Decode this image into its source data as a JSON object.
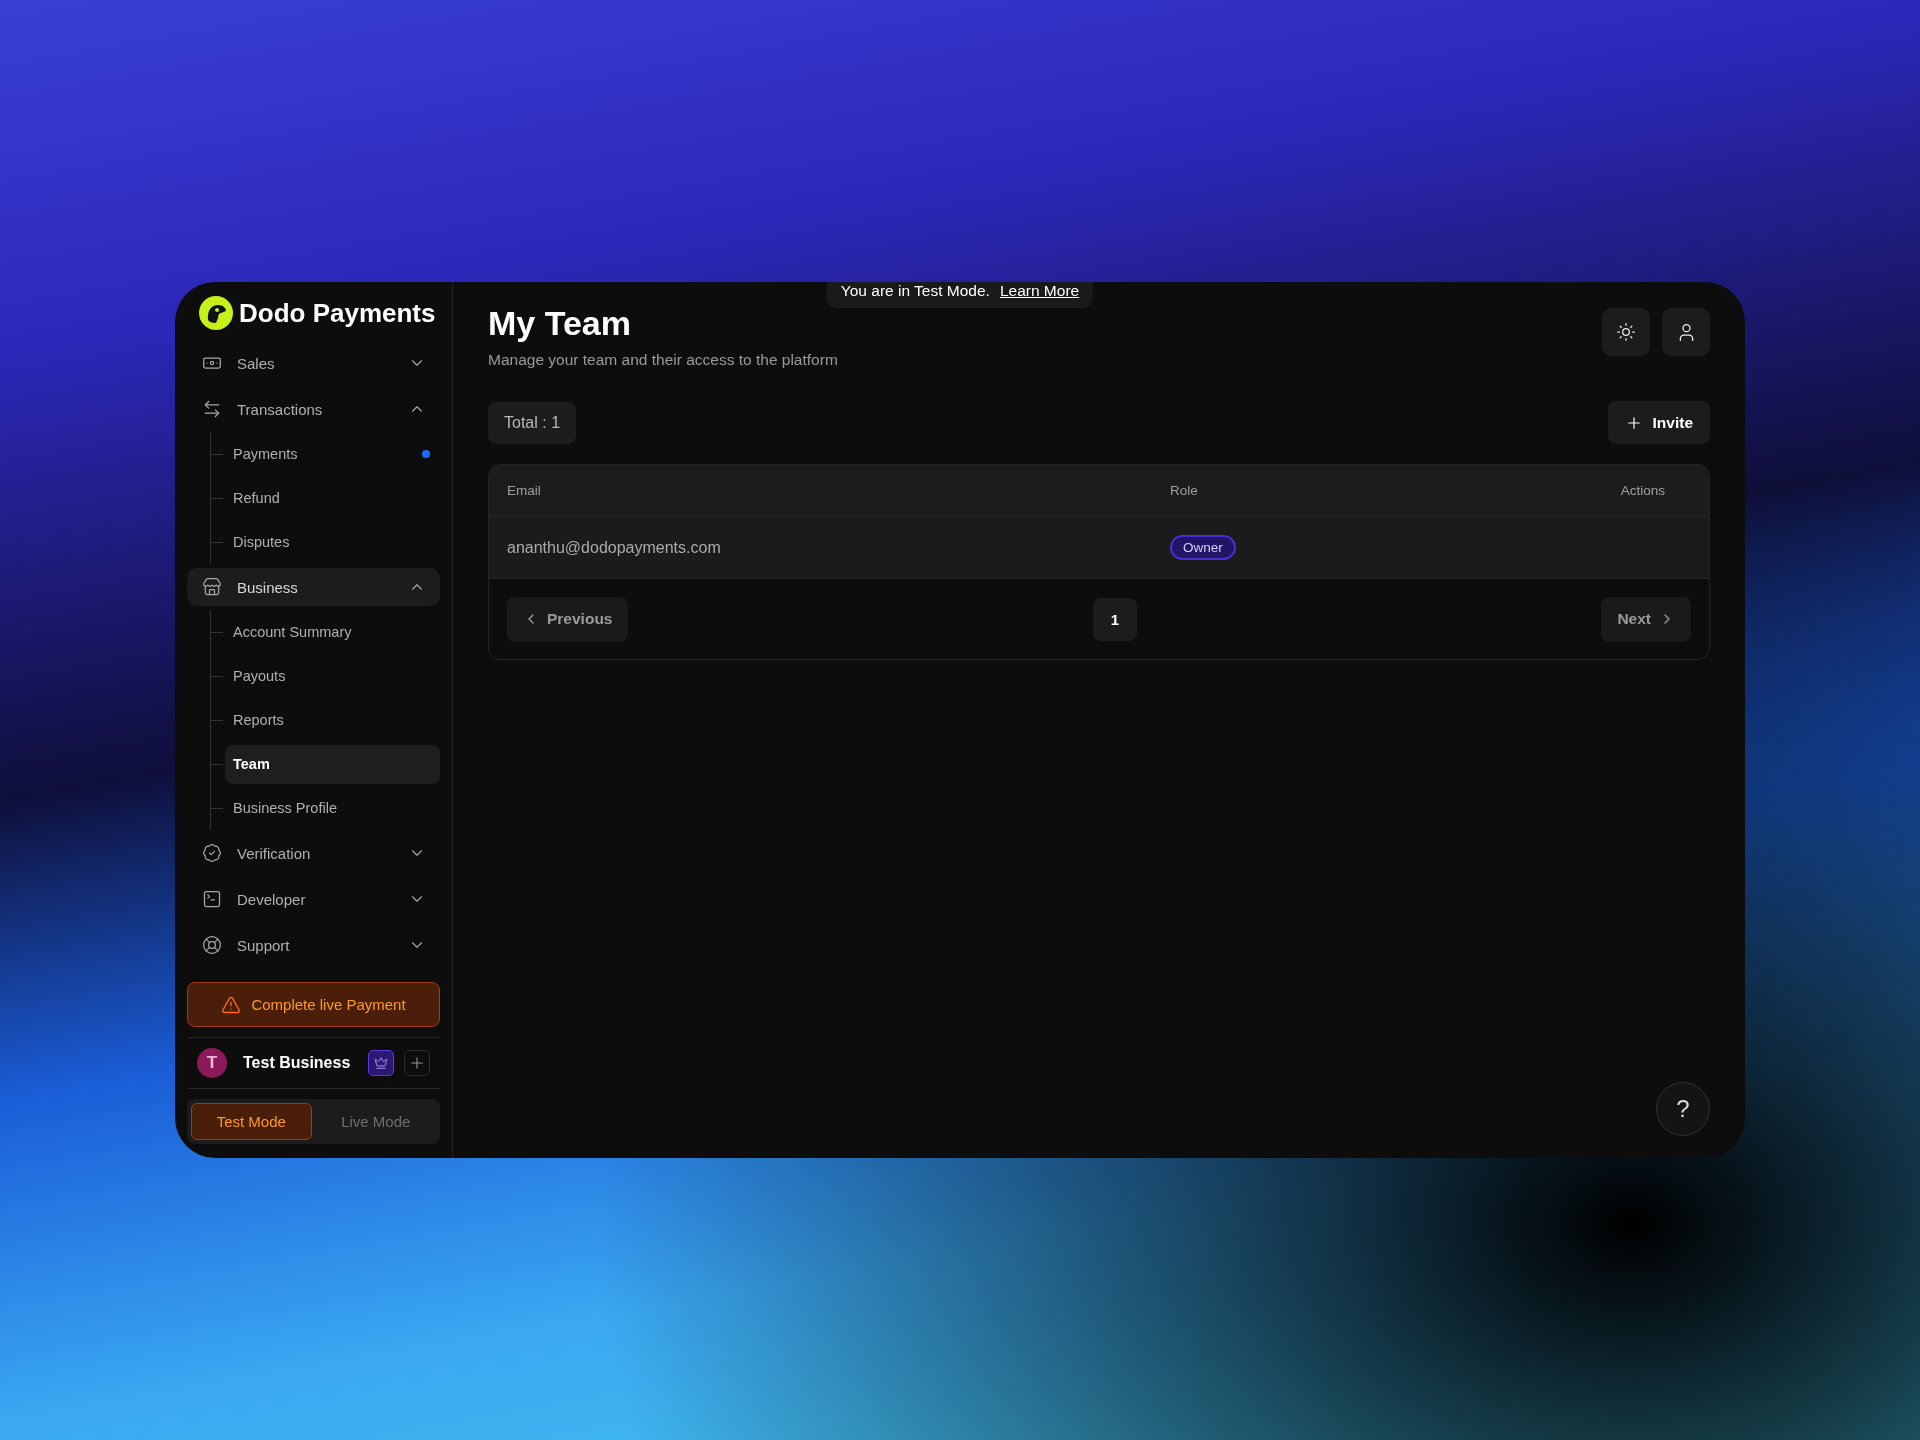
{
  "brand": {
    "name": "Dodo Payments"
  },
  "nav": [
    {
      "label": "Sales",
      "expanded": false,
      "selected": false
    },
    {
      "label": "Transactions",
      "expanded": true,
      "selected": false,
      "children": [
        {
          "label": "Payments",
          "selected": false,
          "dot": true
        },
        {
          "label": "Refund",
          "selected": false,
          "dot": false
        },
        {
          "label": "Disputes",
          "selected": false,
          "dot": false
        }
      ]
    },
    {
      "label": "Business",
      "expanded": true,
      "selected": true,
      "children": [
        {
          "label": "Account Summary",
          "selected": false,
          "dot": false
        },
        {
          "label": "Payouts",
          "selected": false,
          "dot": false
        },
        {
          "label": "Reports",
          "selected": false,
          "dot": false
        },
        {
          "label": "Team",
          "selected": true,
          "dot": false
        },
        {
          "label": "Business Profile",
          "selected": false,
          "dot": false
        }
      ]
    },
    {
      "label": "Verification",
      "expanded": false,
      "selected": false
    },
    {
      "label": "Developer",
      "expanded": false,
      "selected": false
    },
    {
      "label": "Support",
      "expanded": false,
      "selected": false
    }
  ],
  "alert_button": "Complete live Payment",
  "business": {
    "initial": "T",
    "name": "Test Business"
  },
  "modes": [
    {
      "label": "Test Mode",
      "selected": true
    },
    {
      "label": "Live Mode",
      "selected": false
    }
  ],
  "banner": {
    "text": "You are in Test Mode.",
    "link": "Learn More"
  },
  "page": {
    "title": "My Team",
    "subtitle": "Manage your team and their access to the platform"
  },
  "total": "Total : 1",
  "invite_button": "Invite",
  "table": {
    "columns": [
      "Email",
      "Role",
      "Actions"
    ],
    "rows": [
      {
        "email": "ananthu@dodopayments.com",
        "role": "Owner"
      }
    ]
  },
  "pagination": {
    "previous": "Previous",
    "next": "Next",
    "pages": [
      {
        "label": "1",
        "selected": true
      }
    ]
  },
  "help": "?"
}
